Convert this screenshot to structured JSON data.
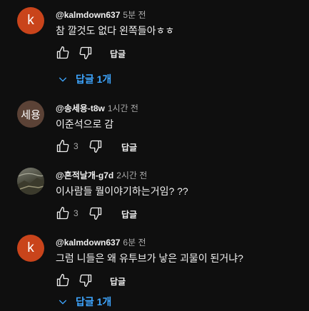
{
  "comments": [
    {
      "author": "@kalmdown637",
      "time": "5분 전",
      "text": "참 깔것도 없다 왼쪽들아ㅎㅎ",
      "avatar": "k",
      "like_count": "",
      "reply_label": "답글",
      "replies_toggle": "답글 1개"
    },
    {
      "author": "@송세용-t8w",
      "time": "1시간 전",
      "text": "이준석으로 감",
      "avatar": "세용",
      "like_count": "3",
      "reply_label": "답글"
    },
    {
      "author": "@흔적날개-g7d",
      "time": "2시간 전",
      "text": "이사람들 뭘이야기하는거임? ??",
      "avatar": "",
      "like_count": "3",
      "reply_label": "답글"
    },
    {
      "author": "@kalmdown637",
      "time": "6분 전",
      "text": "그럼 니들은 왜 유투브가 낳은 괴물이 된거냐?",
      "avatar": "k",
      "like_count": "",
      "reply_label": "답글",
      "replies_toggle": "답글 1개"
    }
  ],
  "icons": {
    "like": "thumb-up-icon",
    "dislike": "thumb-down-icon",
    "expand": "chevron-down-icon"
  },
  "colors": {
    "background": "#0f0f0f",
    "link": "#3ea6ff",
    "avatar_k": "#c9441b",
    "avatar_song": "#5b4236"
  }
}
